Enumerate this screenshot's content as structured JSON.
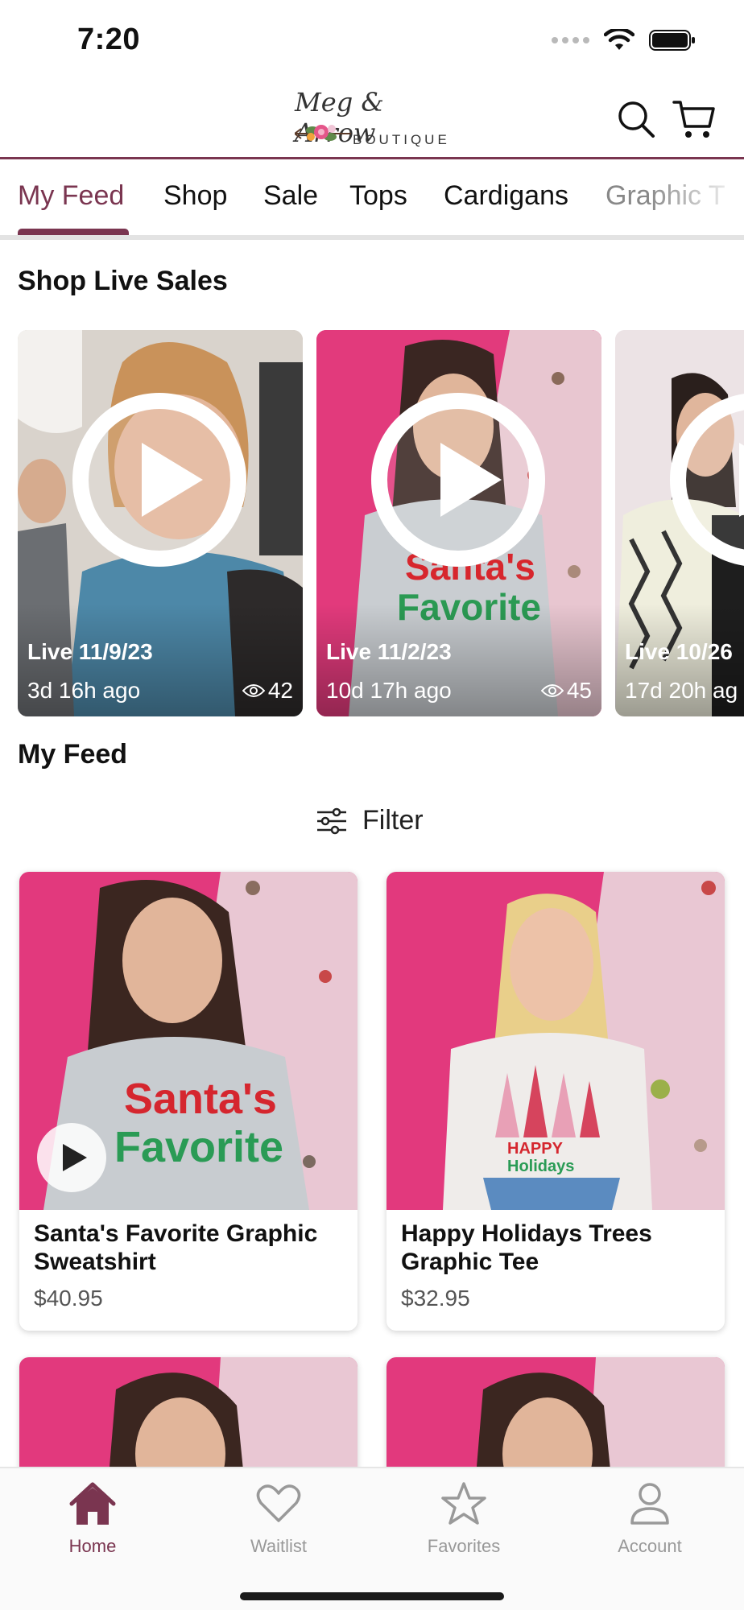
{
  "status_bar": {
    "time": "7:20"
  },
  "header": {
    "logo_script": "Meg & Arrow",
    "logo_sub": "BOUTIQUE"
  },
  "tabs": [
    {
      "label": "My Feed",
      "active": true
    },
    {
      "label": "Shop"
    },
    {
      "label": "Sale"
    },
    {
      "label": "Tops"
    },
    {
      "label": "Cardigans"
    },
    {
      "label": "Graphic T"
    }
  ],
  "live_section": {
    "title": "Shop Live Sales",
    "items": [
      {
        "label": "Live 11/9/23",
        "ago": "3d 16h ago",
        "views": "42"
      },
      {
        "label": "Live 11/2/23",
        "ago": "10d 17h ago",
        "views": "45"
      },
      {
        "label": "Live 10/26",
        "ago": "17d 20h ag",
        "views": ""
      }
    ]
  },
  "feed": {
    "title": "My Feed",
    "filter_label": "Filter",
    "products": [
      {
        "name": "Santa's Favorite Graphic Sweatshirt",
        "price": "$40.95",
        "shirt_text_1": "Santa's",
        "shirt_text_2": "Favorite"
      },
      {
        "name": "Happy Holidays Trees Graphic Tee",
        "price": "$32.95",
        "shirt_text_1": "HAPPY",
        "shirt_text_2": "Holidays"
      }
    ]
  },
  "bottom_nav": [
    {
      "label": "Home",
      "icon": "home-icon",
      "active": true
    },
    {
      "label": "Waitlist",
      "icon": "heart-icon"
    },
    {
      "label": "Favorites",
      "icon": "star-icon"
    },
    {
      "label": "Account",
      "icon": "person-icon"
    }
  ],
  "colors": {
    "accent": "#7a3550",
    "pink_bg": "#e8357a"
  }
}
